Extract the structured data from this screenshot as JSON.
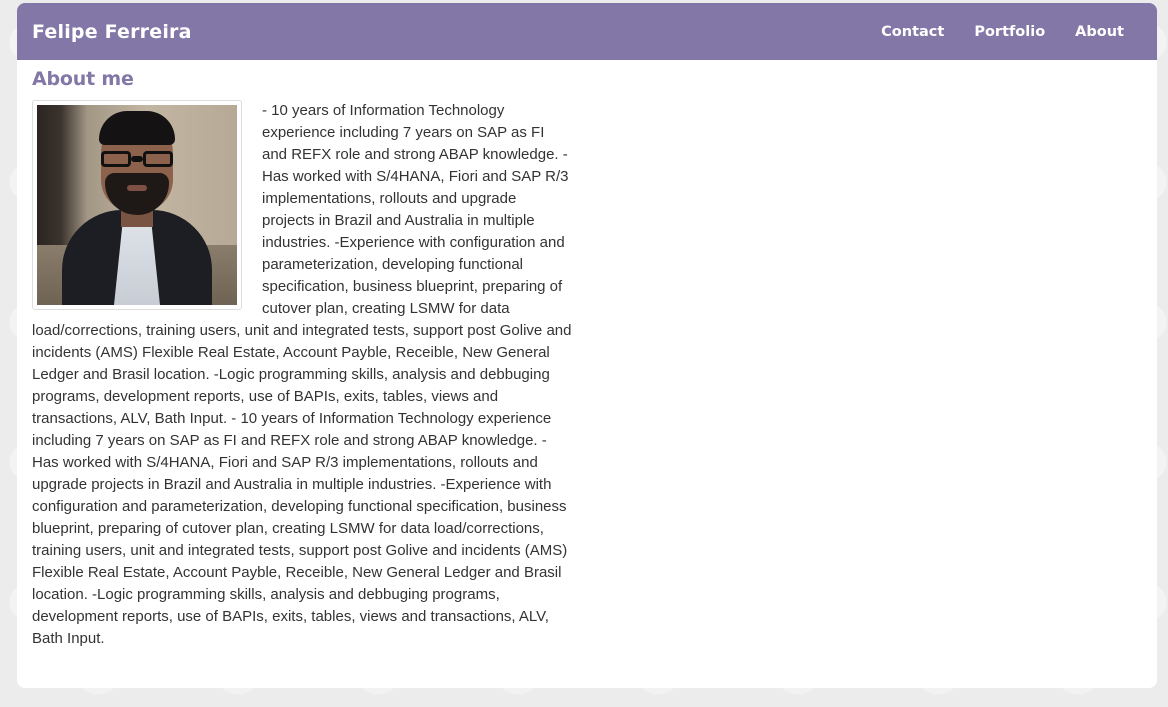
{
  "navbar": {
    "brand": "Felipe Ferreira",
    "links": [
      {
        "label": "Contact"
      },
      {
        "label": "Portfolio"
      },
      {
        "label": "About"
      }
    ]
  },
  "about": {
    "title": "About me",
    "photo_icon": "profile-photo",
    "text": "- 10 years of Information Technology experience including 7 years on SAP as FI and REFX role and strong ABAP knowledge. - Has worked with S/4HANA, Fiori and SAP R/3 implementations, rollouts and upgrade projects in Brazil and Australia in multiple industries. -Experience with configuration and parameterization, developing functional specification, business blueprint, preparing of cutover plan, creating LSMW for data load/corrections, training users, unit and integrated tests, support post Golive and incidents (AMS) Flexible Real Estate, Account Payble, Receible, New General Ledger and Brasil location. -Logic programming skills, analysis and debbuging programs, development reports, use of BAPIs, exits, tables, views and transactions, ALV, Bath Input. - 10 years of Information Technology experience including 7 years on SAP as FI and REFX role and strong ABAP knowledge. - Has worked with S/4HANA, Fiori and SAP R/3 implementations, rollouts and upgrade projects in Brazil and Australia in multiple industries. -Experience with configuration and parameterization, developing functional specification, business blueprint, preparing of cutover plan, creating LSMW for data load/corrections, training users, unit and integrated tests, support post Golive and incidents (AMS) Flexible Real Estate, Account Payble, Receible, New General Ledger and Brasil location. -Logic programming skills, analysis and debbuging programs, development reports, use of BAPIs, exits, tables, views and transactions, ALV, Bath Input."
  },
  "colors": {
    "accent": "#8277a7",
    "background": "#ececec",
    "card": "#ffffff",
    "text": "#333333"
  }
}
